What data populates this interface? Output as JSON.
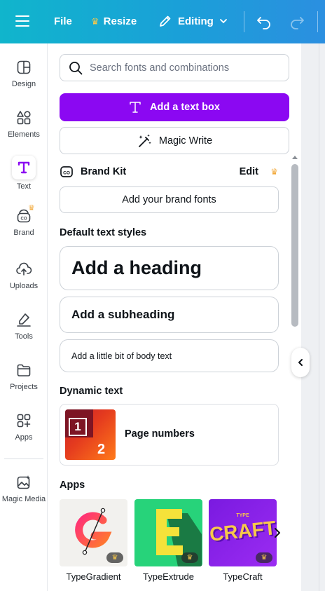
{
  "topbar": {
    "file_label": "File",
    "resize_label": "Resize",
    "editing_label": "Editing",
    "menu_icon": "hamburger-icon",
    "crown_icon": "crown-icon",
    "pencil_icon": "pencil-icon",
    "undo_icon": "undo-icon",
    "redo_icon": "redo-icon",
    "gradient_start": "#10b5cc",
    "gradient_end": "#2b8fe0"
  },
  "sidebar": {
    "items": [
      {
        "label": "Design",
        "icon": "design-icon"
      },
      {
        "label": "Elements",
        "icon": "elements-icon"
      },
      {
        "label": "Text",
        "icon": "text-icon",
        "active": true
      },
      {
        "label": "Brand",
        "icon": "brand-icon"
      },
      {
        "label": "Uploads",
        "icon": "uploads-icon"
      },
      {
        "label": "Tools",
        "icon": "tools-icon"
      },
      {
        "label": "Projects",
        "icon": "projects-icon"
      },
      {
        "label": "Apps",
        "icon": "apps-icon"
      },
      {
        "label": "Magic Media",
        "icon": "magic-media-icon"
      }
    ],
    "active_color": "#8b08f2"
  },
  "panel": {
    "search": {
      "placeholder": "Search fonts and combinations"
    },
    "add_text_box_label": "Add a text box",
    "magic_write_label": "Magic Write",
    "brand_kit": {
      "label": "Brand Kit",
      "edit_label": "Edit",
      "add_fonts_label": "Add your brand fonts"
    },
    "default_styles_title": "Default text styles",
    "styles": {
      "heading": "Add a heading",
      "subheading": "Add a subheading",
      "body": "Add a little bit of body text"
    },
    "dynamic_text_title": "Dynamic text",
    "dynamic_text_item": {
      "label": "Page numbers",
      "thumb_numbers": [
        "1",
        "2"
      ]
    },
    "apps_title": "Apps",
    "apps": [
      {
        "name": "TypeGradient"
      },
      {
        "name": "TypeExtrude"
      },
      {
        "name": "TypeCraft",
        "thumb_text": "CRAFT",
        "thumb_small": "TYPE"
      }
    ],
    "primary_color": "#8b08f2"
  }
}
